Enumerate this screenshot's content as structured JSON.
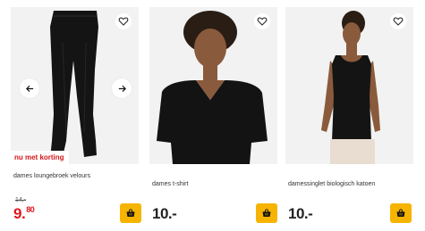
{
  "colors": {
    "sale_red": "#e0141c",
    "cart_yellow": "#f6b400",
    "image_bg": "#f2f2f2"
  },
  "products": [
    {
      "name": "dames loungebroek velours",
      "badge": "nu met korting",
      "old_price": "14,-",
      "price_main": "9.",
      "price_cents": "80",
      "icons": [
        "heart-icon",
        "arrow-left-icon",
        "arrow-right-icon",
        "basket-icon"
      ]
    },
    {
      "name": "dames t-shirt",
      "price_main": "10.-",
      "icons": [
        "heart-icon",
        "basket-icon"
      ]
    },
    {
      "name": "damessinglet biologisch katoen",
      "price_main": "10.-",
      "icons": [
        "heart-icon",
        "basket-icon"
      ]
    }
  ]
}
